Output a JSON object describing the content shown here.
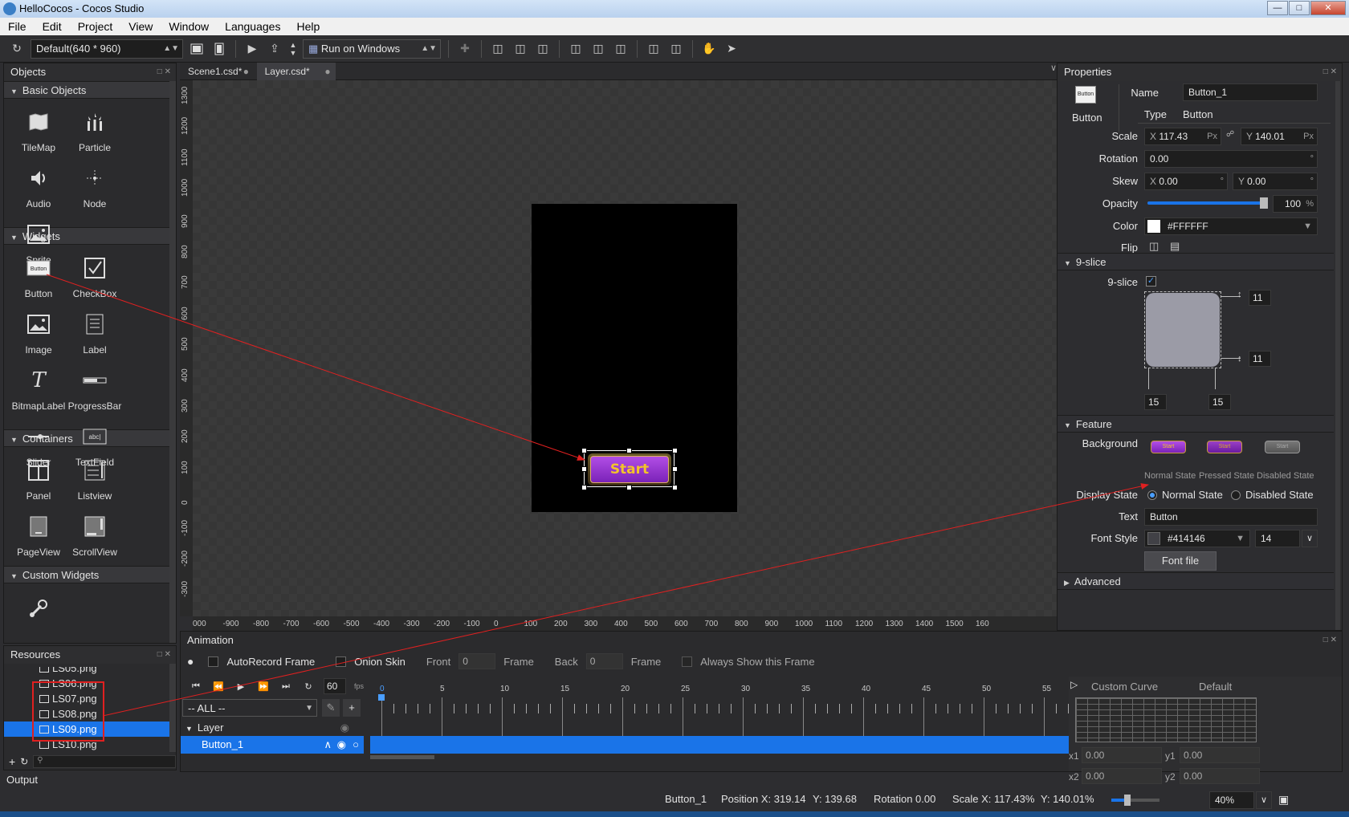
{
  "window": {
    "title": "HelloCocos - Cocos Studio",
    "min": "0",
    "max": "1",
    "close": "r"
  },
  "menu": [
    "File",
    "Edit",
    "Project",
    "View",
    "Window",
    "Languages",
    "Help"
  ],
  "toolbar": {
    "resolution": "Default(640 * 960)",
    "run_target": "Run on Windows"
  },
  "objects_panel": {
    "title": "Objects",
    "sections": [
      {
        "title": "Basic Objects",
        "items": [
          "TileMap",
          "Particle",
          "Audio",
          "Node",
          "Sprite"
        ]
      },
      {
        "title": "Widgets",
        "items": [
          "Button",
          "CheckBox",
          "Image",
          "Label",
          "BitmapLabel",
          "ProgressBar",
          "Slider",
          "TextField"
        ]
      },
      {
        "title": "Containers",
        "items": [
          "Panel",
          "Listview",
          "PageView",
          "ScrollView"
        ]
      },
      {
        "title": "Custom Widgets",
        "items": []
      }
    ]
  },
  "resources_panel": {
    "title": "Resources",
    "files": [
      {
        "name": "LS05.png",
        "selected": false
      },
      {
        "name": "LS06.png",
        "selected": false
      },
      {
        "name": "LS07.png",
        "selected": false
      },
      {
        "name": "LS08.png",
        "selected": false
      },
      {
        "name": "LS09.png",
        "selected": true
      },
      {
        "name": "LS10.png",
        "selected": false
      }
    ]
  },
  "editor": {
    "tabs": [
      {
        "label": "Scene1.csd*",
        "active": false
      },
      {
        "label": "Layer.csd*",
        "active": true
      }
    ],
    "button_text": "Start",
    "hruler": [
      "000",
      "-900",
      "-800",
      "-700",
      "-600",
      "-500",
      "-400",
      "-300",
      "-200",
      "-100",
      "0",
      "100",
      "200",
      "300",
      "400",
      "500",
      "600",
      "700",
      "800",
      "900",
      "1000",
      "1100",
      "1200",
      "1300",
      "1400",
      "1500",
      "160"
    ],
    "vruler": [
      "1300",
      "1200",
      "1100",
      "1000",
      "900",
      "800",
      "700",
      "600",
      "500",
      "400",
      "300",
      "200",
      "100",
      "0",
      "-100",
      "-200",
      "-300"
    ]
  },
  "properties": {
    "title": "Properties",
    "widget_type_icon_label": "Button",
    "widget_type_caption": "Button",
    "name_label": "Name",
    "name_value": "Button_1",
    "type_label": "Type",
    "type_value": "Button",
    "scale_label": "Scale",
    "scale_x": "117.43",
    "scale_y": "140.01",
    "unit": "Px",
    "rotation_label": "Rotation",
    "rotation_value": "0.00",
    "skew_label": "Skew",
    "skew_x": "0.00",
    "skew_y": "0.00",
    "opacity_label": "Opacity",
    "opacity_value": "100",
    "opacity_unit": "%",
    "opacity_fraction": 1.0,
    "color_label": "Color",
    "color_value": "#FFFFFF",
    "flip_label": "Flip",
    "nine_slice_section": "9-slice",
    "nine_slice_label": "9-slice",
    "nine_slice_checked": true,
    "slice_top": "11",
    "slice_bottom": "11",
    "slice_left": "15",
    "slice_right": "15",
    "feature_section": "Feature",
    "background_label": "Background",
    "bg_states": [
      "Normal State",
      "Pressed State",
      "Disabled State"
    ],
    "display_state_label": "Display State",
    "display_state_options": [
      "Normal State",
      "Disabled State"
    ],
    "display_state_selected": "Normal State",
    "text_label": "Text",
    "text_value": "Button",
    "font_style_label": "Font Style",
    "font_color": "#414146",
    "font_size": "14",
    "font_file_button": "Font file",
    "advanced_section": "Advanced"
  },
  "animation": {
    "title": "Animation",
    "autorecord_label": "AutoRecord Frame",
    "onion_label": "Onion Skin",
    "front_label": "Front",
    "front_value": "0",
    "frame_label": "Frame",
    "back_label": "Back",
    "back_value": "0",
    "frame_label2": "Frame",
    "always_show_label": "Always Show this Frame",
    "fps_value": "60",
    "fps_unit": "fps",
    "filter": "-- ALL --",
    "layer_label": "Layer",
    "node_label": "Button_1",
    "ticks": [
      "0",
      "5",
      "10",
      "15",
      "20",
      "25",
      "30",
      "35",
      "40",
      "45",
      "50",
      "55"
    ],
    "custom_curve": "Custom Curve",
    "default_label": "Default",
    "x1_label": "x1",
    "x1_value": "0.00",
    "y1_label": "y1",
    "y1_value": "0.00",
    "x2_label": "x2",
    "x2_value": "0.00",
    "y2_label": "y2",
    "y2_value": "0.00"
  },
  "output": {
    "title": "Output"
  },
  "status": {
    "node": "Button_1",
    "position": "Position X: 319.14",
    "pos_y": "Y: 139.68",
    "rotation": "Rotation 0.00",
    "scale": "Scale X: 117.43%",
    "scale_y": "Y: 140.01%",
    "zoom": "40%"
  },
  "colors": {
    "accent": "#1a74e8",
    "annotation": "#e02020",
    "button_purple": "#8b2fc9",
    "button_text": "#f2c42a"
  }
}
